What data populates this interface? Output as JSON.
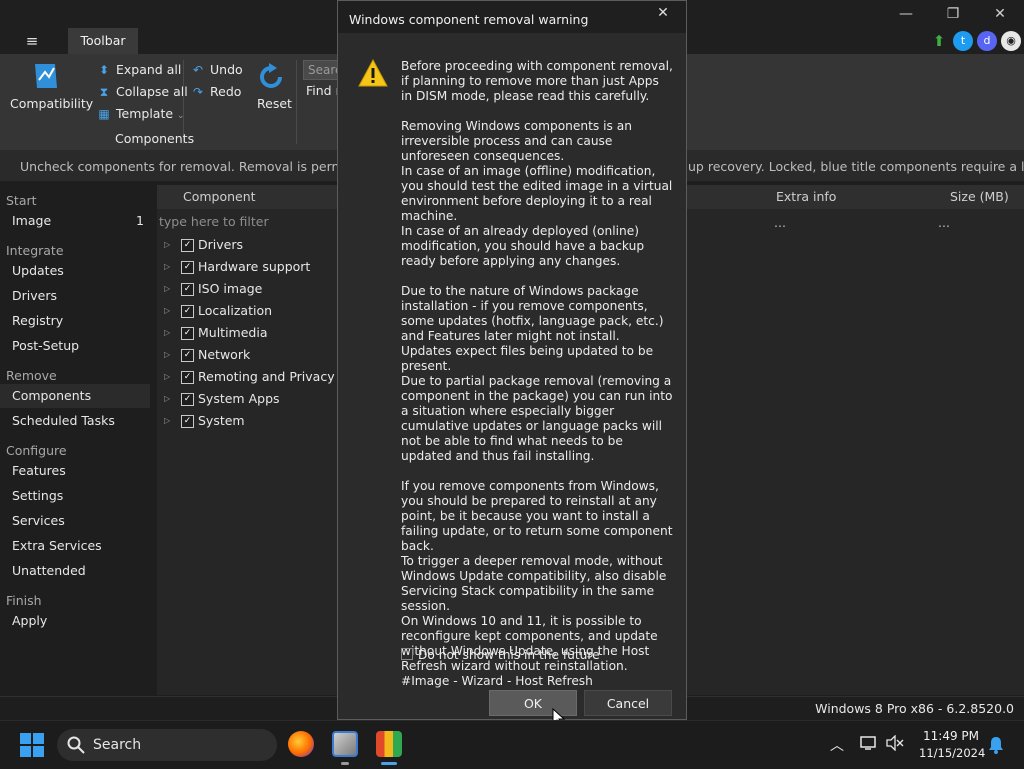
{
  "window": {
    "menu_icon": "hamburger-icon",
    "tab": "Toolbar"
  },
  "ribbon": {
    "compatibility": "Compatibility",
    "expand_all": "Expand all",
    "collapse_all": "Collapse all",
    "template": "Template",
    "undo": "Undo",
    "redo": "Redo",
    "reset": "Reset",
    "group_components": "Components",
    "search_placeholder": "Search",
    "find_label": "Find n"
  },
  "info_bar": {
    "left": "Uncheck components for removal. Removal is permanent, r",
    "right": "up recovery. Locked, blue title components require a license."
  },
  "sidebar": {
    "sections": [
      {
        "title": "Start",
        "items": [
          {
            "label": "Image",
            "count": "1"
          }
        ]
      },
      {
        "title": "Integrate",
        "items": [
          {
            "label": "Updates"
          },
          {
            "label": "Drivers"
          },
          {
            "label": "Registry"
          },
          {
            "label": "Post-Setup"
          }
        ]
      },
      {
        "title": "Remove",
        "items": [
          {
            "label": "Components"
          },
          {
            "label": "Scheduled Tasks"
          }
        ]
      },
      {
        "title": "Configure",
        "items": [
          {
            "label": "Features"
          },
          {
            "label": "Settings"
          },
          {
            "label": "Services"
          },
          {
            "label": "Extra Services"
          },
          {
            "label": "Unattended"
          }
        ]
      },
      {
        "title": "Finish",
        "items": [
          {
            "label": "Apply"
          }
        ]
      }
    ]
  },
  "list": {
    "headers": {
      "component": "Component",
      "extra": "Extra info",
      "size": "Size (MB)"
    },
    "filter_placeholder": "type here to filter",
    "dots": "...",
    "rows": [
      "Drivers",
      "Hardware support",
      "ISO image",
      "Localization",
      "Multimedia",
      "Network",
      "Remoting and Privacy",
      "System Apps",
      "System"
    ]
  },
  "status": "Windows 8 Pro x86 - 6.2.8520.0",
  "dialog": {
    "title": "Windows component removal warning",
    "paragraphs": [
      "Before proceeding with component removal, if planning to remove more than just Apps in DISM mode, please read this carefully.",
      "Removing Windows components is an irreversible process and can cause unforeseen consequences.\nIn case of an image (offline) modification, you should test the edited image in a virtual environment before deploying it to a real machine.\nIn case of an already deployed (online) modification, you should have a backup ready before applying any changes.",
      "Due to the nature of Windows package installation - if you remove components, some updates (hotfix, language pack, etc.) and Features later might not install.\nUpdates expect files being updated to be present.\nDue to partial package removal (removing a component in the package) you can run into a situation where especially bigger cumulative updates or language packs will not be able to find what needs to be updated and thus fail installing.",
      "If you remove components from Windows, you should be prepared to reinstall at any point, be it because you want to install a failing update, or to return some component back.\nTo trigger a deeper removal mode, without Windows Update compatibility, also disable Servicing Stack compatibility in the same session.\nOn Windows 10 and 11, it is possible to reconfigure kept components, and update without Windows Update, using the Host Refresh wizard without reinstallation. #Image - Wizard - Host Refresh"
    ],
    "dont_show": "Do not show this in the future",
    "ok": "OK",
    "cancel": "Cancel"
  },
  "taskbar": {
    "search": "Search",
    "time": "11:49 PM",
    "date": "11/15/2024"
  },
  "colors": {
    "accent_blue": "#4aa3e8",
    "warning_yellow": "#f5c518"
  }
}
